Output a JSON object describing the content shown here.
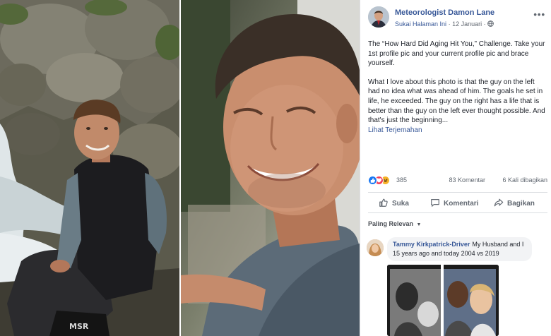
{
  "post": {
    "author": "Meteorologist Damon Lane",
    "page_label": "Sukai Halaman Ini",
    "separator": "·",
    "date": "12 Januari",
    "separator2": "·",
    "more": "•••",
    "paragraph1": "The “How Hard Did Aging Hit You,” Challenge. Take your 1st profile pic and your current profile pic and brace yourself.",
    "paragraph2": "What I love about this photo is that the guy on the left had no idea what was ahead of him. The goals he set in life, he exceeded. The guy on the right has a life that is better than the guy on the left ever thought possible. And that's just the beginning...",
    "translate": "Lihat Terjemahan"
  },
  "stats": {
    "reactions": "385",
    "comments": "83 Komentar",
    "shares": "6 Kali dibagikan"
  },
  "actions": {
    "like": "Suka",
    "comment": "Komentari",
    "share": "Bagikan"
  },
  "sort": {
    "label": "Paling Relevan",
    "caret": "▼"
  },
  "comment": {
    "name": "Tammy Kirkpatrick-Driver",
    "text": "My Husband and I 15 years ago and today 2004 vs 2019"
  },
  "colors": {
    "link": "#385898",
    "like": "#1877f2",
    "love": "#f33e58",
    "haha": "#f7b125"
  },
  "icons": [
    "globe-icon",
    "more-icon",
    "like-reaction-icon",
    "love-reaction-icon",
    "haha-reaction-icon",
    "thumbs-up-icon",
    "comment-icon",
    "share-icon",
    "caret-down-icon"
  ]
}
